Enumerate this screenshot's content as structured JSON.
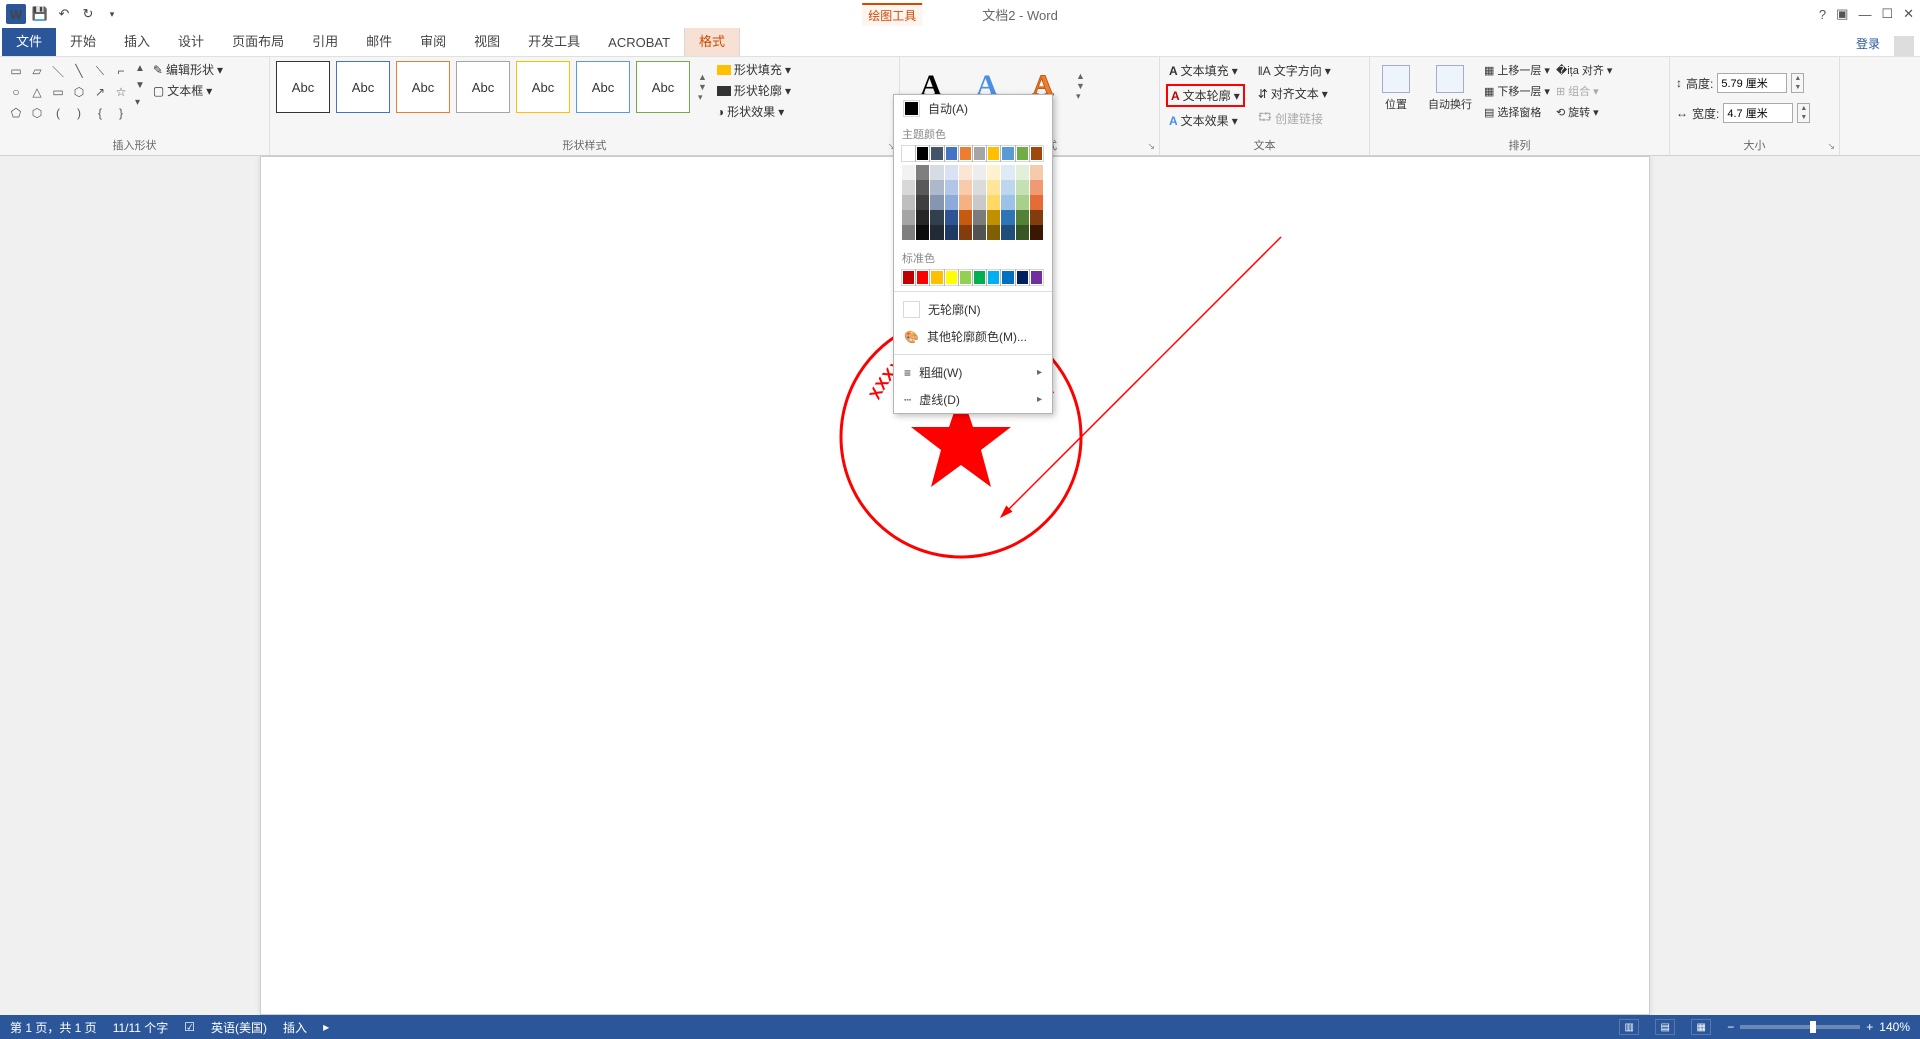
{
  "titlebar": {
    "contextual_tab": "绘图工具",
    "doc_title": "文档2 - Word",
    "login": "登录"
  },
  "tabs": {
    "file": "文件",
    "list": [
      "开始",
      "插入",
      "设计",
      "页面布局",
      "引用",
      "邮件",
      "审阅",
      "视图",
      "开发工具",
      "ACROBAT"
    ],
    "active": "格式"
  },
  "group_labels": {
    "shapes": "插入形状",
    "styles": "形状样式",
    "wordart": "艺术字样式",
    "text": "文本",
    "arrange": "排列",
    "size": "大小"
  },
  "shape_edit": {
    "edit": "编辑形状",
    "textbox": "文本框"
  },
  "style_items": [
    "Abc",
    "Abc",
    "Abc",
    "Abc",
    "Abc",
    "Abc",
    "Abc"
  ],
  "shape_buttons": {
    "fill": "形状填充",
    "outline": "形状轮廓",
    "effects": "形状效果"
  },
  "text_buttons": {
    "fill": "文本填充",
    "outline": "文本轮廓",
    "effects": "文本效果",
    "dir": "文字方向",
    "align": "对齐文本",
    "link": "创建链接"
  },
  "arrange": {
    "position": "位置",
    "wrap": "自动换行",
    "front": "上移一层",
    "back": "下移一层",
    "pane": "选择窗格",
    "align": "对齐",
    "group": "组合",
    "rotate": "旋转"
  },
  "size": {
    "h_label": "高度:",
    "h_val": "5.79 厘米",
    "w_label": "宽度:",
    "w_val": "4.7 厘米"
  },
  "dropdown": {
    "auto": "自动(A)",
    "theme": "主题颜色",
    "standard": "标准色",
    "none": "无轮廓(N)",
    "more": "其他轮廓颜色(M)...",
    "weight": "粗细(W)",
    "dash": "虚线(D)",
    "theme_row1": [
      "#ffffff",
      "#000000",
      "#44546a",
      "#4472c4",
      "#ed7d31",
      "#a5a5a5",
      "#ffc000",
      "#5b9bd5",
      "#70ad47",
      "#9e480e"
    ],
    "theme_shades": [
      [
        "#f2f2f2",
        "#7f7f7f",
        "#d6dce4",
        "#d9e2f3",
        "#fbe5d5",
        "#ededed",
        "#fff2cc",
        "#deebf6",
        "#e2efd9",
        "#f7caac"
      ],
      [
        "#d8d8d8",
        "#595959",
        "#adb9ca",
        "#b4c6e7",
        "#f7cbac",
        "#dbdbdb",
        "#fee599",
        "#bdd7ee",
        "#c5e0b3",
        "#ef9a73"
      ],
      [
        "#bfbfbf",
        "#3f3f3f",
        "#8496b0",
        "#8eaadb",
        "#f4b183",
        "#c9c9c9",
        "#ffd965",
        "#9cc3e5",
        "#a8d08d",
        "#e66c37"
      ],
      [
        "#a5a5a5",
        "#262626",
        "#323f4f",
        "#2f5496",
        "#c55a11",
        "#7b7b7b",
        "#bf9000",
        "#2e75b5",
        "#538135",
        "#833c0b"
      ],
      [
        "#7f7f7f",
        "#0c0c0c",
        "#222a35",
        "#1f3864",
        "#833c0b",
        "#525252",
        "#7f6000",
        "#1e4e79",
        "#375623",
        "#3b1703"
      ]
    ],
    "standard_colors": [
      "#c00000",
      "#ff0000",
      "#ffc000",
      "#ffff00",
      "#92d050",
      "#00b050",
      "#00b0f0",
      "#0070c0",
      "#002060",
      "#7030a0"
    ]
  },
  "stamp_text": "XXXX 建筑装饰工程有限公司",
  "statusbar": {
    "page": "第 1 页，共 1 页",
    "words": "11/11 个字",
    "lang": "英语(美国)",
    "mode": "插入",
    "zoom": "140%"
  }
}
